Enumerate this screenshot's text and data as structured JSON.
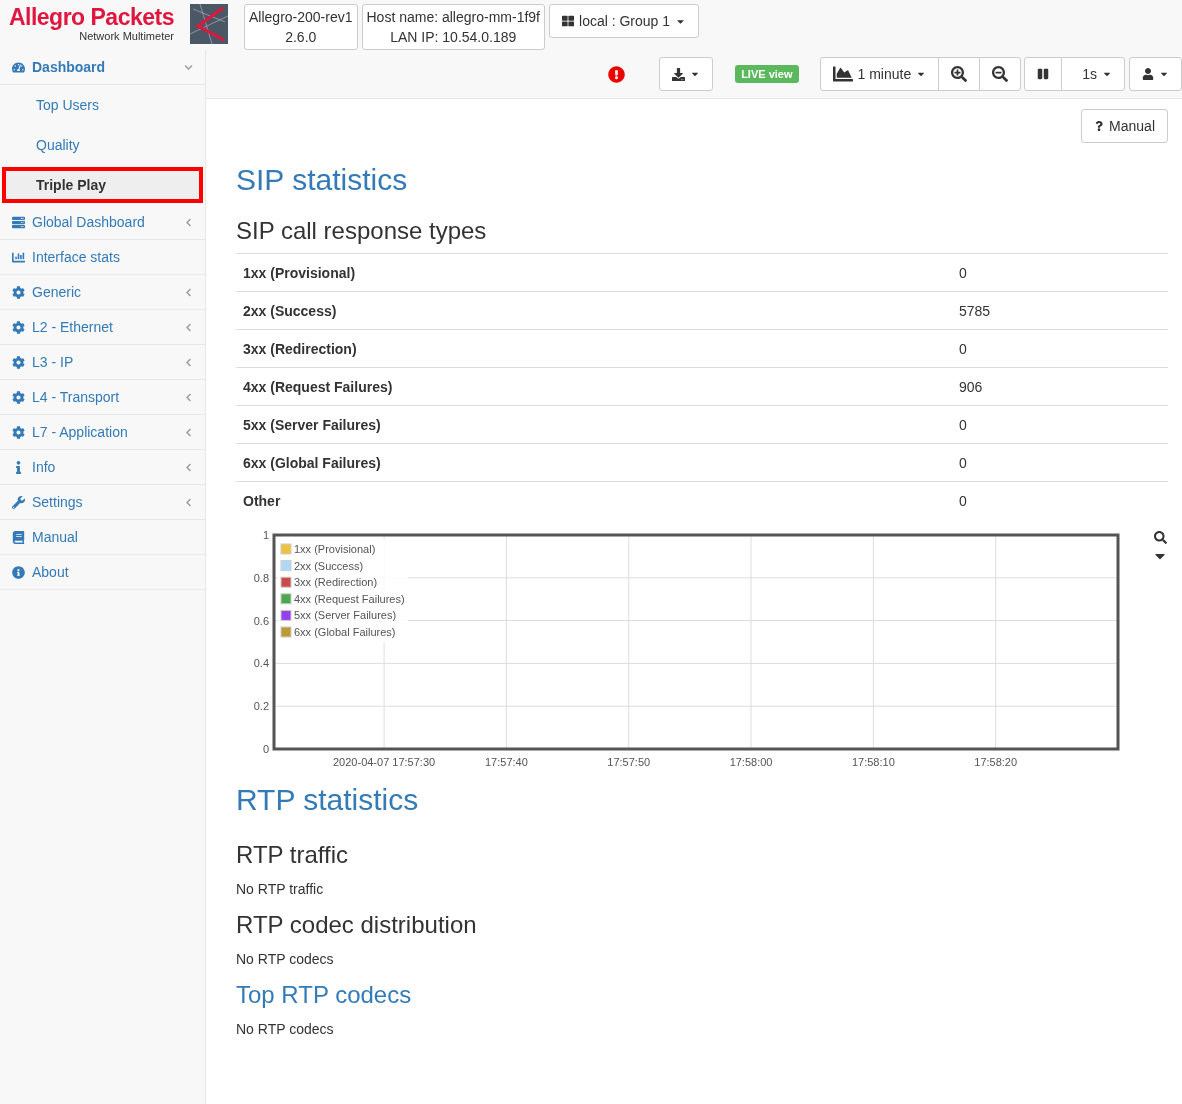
{
  "brand": {
    "name": "Allegro Packets",
    "subtitle": "Network Multimeter"
  },
  "device": {
    "model": "Allegro-200-rev1",
    "version": "2.6.0"
  },
  "host": {
    "name": "Host name: allegro-mm-1f9f",
    "ip": "LAN IP: 10.54.0.189"
  },
  "group_selector": {
    "label": "local : Group 1"
  },
  "toolbar": {
    "alert": true,
    "live_badge": "LIVE view",
    "timespan": "1 minute",
    "interval": "1s",
    "paused": false
  },
  "sidebar": {
    "items": [
      {
        "label": "Dashboard",
        "expanded": true,
        "children": [
          {
            "label": "Top Users",
            "selected": false
          },
          {
            "label": "Quality",
            "selected": false
          },
          {
            "label": "Triple Play",
            "selected": true
          }
        ]
      },
      {
        "label": "Global Dashboard",
        "expanded": false
      },
      {
        "label": "Interface stats"
      },
      {
        "label": "Generic",
        "expanded": false
      },
      {
        "label": "L2 - Ethernet",
        "expanded": false
      },
      {
        "label": "L3 - IP",
        "expanded": false
      },
      {
        "label": "L4 - Transport",
        "expanded": false
      },
      {
        "label": "L7 - Application",
        "expanded": false
      },
      {
        "label": "Info",
        "expanded": false
      },
      {
        "label": "Settings",
        "expanded": false
      },
      {
        "label": "Manual"
      },
      {
        "label": "About"
      }
    ]
  },
  "manual_button": {
    "label": "Manual"
  },
  "sip": {
    "title": "SIP statistics",
    "subtitle": "SIP call response types",
    "rows": [
      {
        "type": "1xx (Provisional)",
        "count": "0"
      },
      {
        "type": "2xx (Success)",
        "count": "5785"
      },
      {
        "type": "3xx (Redirection)",
        "count": "0"
      },
      {
        "type": "4xx (Request Failures)",
        "count": "906"
      },
      {
        "type": "5xx (Server Failures)",
        "count": "0"
      },
      {
        "type": "6xx (Global Failures)",
        "count": "0"
      },
      {
        "type": "Other",
        "count": "0"
      }
    ],
    "chart_data": {
      "type": "line",
      "grid": true,
      "legend": true,
      "ylim": [
        0,
        1
      ],
      "yticks": [
        0,
        0.2,
        0.4,
        0.6,
        0.8,
        1
      ],
      "categories": [
        "2020-04-07 17:57:30",
        "17:57:40",
        "17:57:50",
        "17:58:00",
        "17:58:10",
        "17:58:20"
      ],
      "series": [
        {
          "name": "1xx (Provisional)",
          "color": "#edc240",
          "values": [
            null,
            null,
            null,
            null,
            null,
            null
          ]
        },
        {
          "name": "2xx (Success)",
          "color": "#afd8f8",
          "values": [
            null,
            null,
            null,
            null,
            null,
            null
          ]
        },
        {
          "name": "3xx (Redirection)",
          "color": "#cb4b4b",
          "values": [
            null,
            null,
            null,
            null,
            null,
            null
          ]
        },
        {
          "name": "4xx (Request Failures)",
          "color": "#4da74d",
          "values": [
            null,
            null,
            null,
            null,
            null,
            null
          ]
        },
        {
          "name": "5xx (Server Failures)",
          "color": "#9440ed",
          "values": [
            null,
            null,
            null,
            null,
            null,
            null
          ]
        },
        {
          "name": "6xx (Global Failures)",
          "color": "#bd9b33",
          "values": [
            null,
            null,
            null,
            null,
            null,
            null
          ]
        }
      ]
    }
  },
  "rtp": {
    "title": "RTP statistics",
    "sections": [
      {
        "kind": "subtitle",
        "heading": "RTP traffic",
        "note": "No RTP traffic"
      },
      {
        "kind": "subtitle",
        "heading": "RTP codec distribution",
        "note": "No RTP codecs"
      },
      {
        "kind": "title",
        "heading": "Top RTP codecs",
        "note": "No RTP codecs"
      }
    ]
  }
}
